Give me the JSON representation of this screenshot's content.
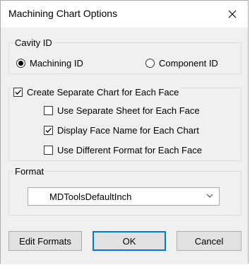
{
  "dialog": {
    "title": "Machining Chart Options",
    "close_icon": "close-icon"
  },
  "cavity_id": {
    "legend": "Cavity ID",
    "options": [
      {
        "label": "Machining ID",
        "selected": true
      },
      {
        "label": "Component ID",
        "selected": false
      }
    ]
  },
  "separate_chart": {
    "label": "Create Separate Chart for Each Face",
    "checked": true,
    "suboptions": [
      {
        "label": "Use Separate Sheet for Each Face",
        "checked": false
      },
      {
        "label": "Display Face Name for Each Chart",
        "checked": true
      },
      {
        "label": "Use Different Format for Each Face",
        "checked": false
      }
    ]
  },
  "format": {
    "legend": "Format",
    "selected": "MDToolsDefaultInch",
    "dropdown_icon": "chevron-down-icon"
  },
  "buttons": {
    "edit_formats": "Edit Formats",
    "ok": "OK",
    "cancel": "Cancel"
  }
}
